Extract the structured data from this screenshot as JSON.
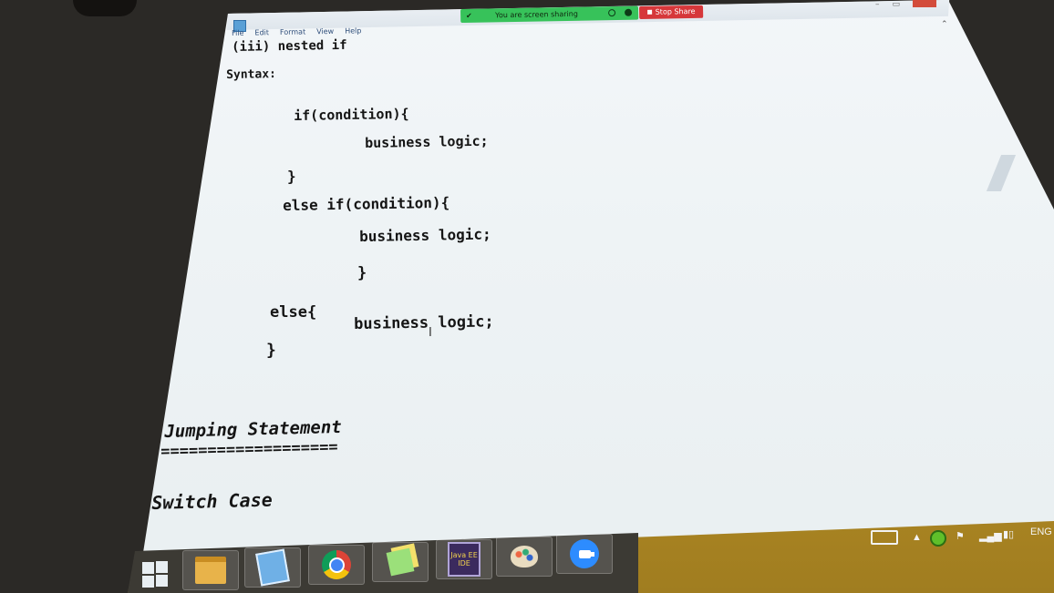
{
  "menu": {
    "items": [
      "File",
      "Edit",
      "Format",
      "View",
      "Help"
    ]
  },
  "sharing": {
    "status_text": "You are screen sharing",
    "stop_label": "Stop Share",
    "color": "#37c25a",
    "stop_color": "#d6373a"
  },
  "document": {
    "lines": [
      "(iii) nested if",
      "Syntax:",
      "if(condition){",
      "business logic;",
      "}",
      "else if(condition){",
      "business logic;",
      "}",
      "else{",
      "business logic;",
      "}",
      "Jumping Statement",
      "===================",
      "Switch Case"
    ]
  },
  "taskbar": {
    "apps": [
      {
        "icon": "file-explorer-icon"
      },
      {
        "icon": "notepad-icon"
      },
      {
        "icon": "chrome-icon"
      },
      {
        "icon": "sticky-notes-icon"
      },
      {
        "icon": "java-ee-ide-icon",
        "label": "Java EE\nIDE"
      },
      {
        "icon": "paint-icon"
      },
      {
        "icon": "zoom-icon"
      }
    ],
    "language": "ENG"
  }
}
